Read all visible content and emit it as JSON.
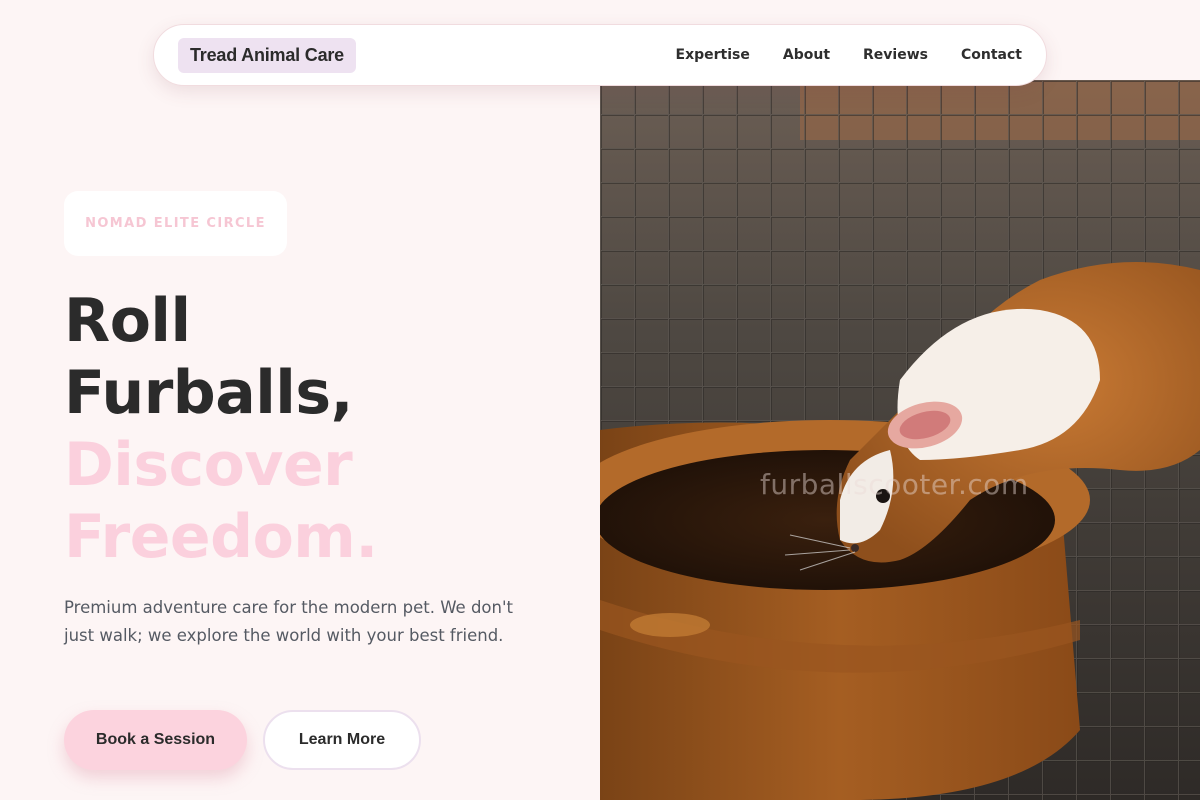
{
  "brand": {
    "name": "Tread Animal Care"
  },
  "nav": {
    "items": [
      {
        "label": "Expertise"
      },
      {
        "label": "About"
      },
      {
        "label": "Reviews"
      },
      {
        "label": "Contact"
      }
    ]
  },
  "hero": {
    "badge": "NOMAD ELITE CIRCLE",
    "headline_line1": "Roll",
    "headline_line2": "Furballs,",
    "headline_line3": "Discover",
    "headline_line4": "Freedom.",
    "subtext": "Premium adventure care for the modern pet. We don't just walk; we explore the world with your best friend.",
    "primary_cta": "Book a Session",
    "secondary_cta": "Learn More",
    "image_watermark": "furballscooter.com"
  },
  "colors": {
    "background": "#fdf5f5",
    "accent_pink": "#fcd3de",
    "headline_pink": "#fbd0dd",
    "brand_badge": "#eee2f1",
    "text_dark": "#2b2b2b"
  }
}
